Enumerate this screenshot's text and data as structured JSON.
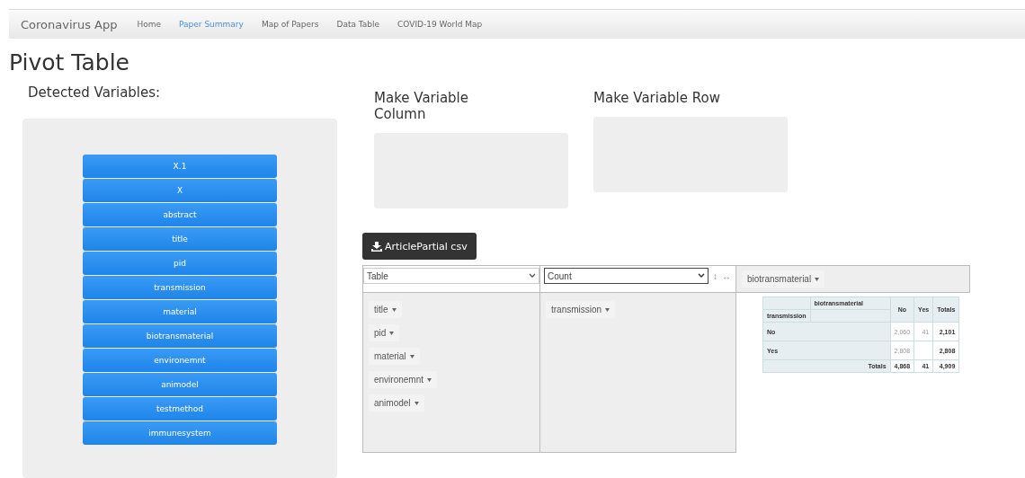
{
  "navbar": {
    "brand": "Coronavirus App",
    "items": [
      {
        "label": "Home",
        "selected": false
      },
      {
        "label": "Paper Summary",
        "selected": true
      },
      {
        "label": "Map of Papers",
        "selected": false
      },
      {
        "label": "Data Table",
        "selected": false
      },
      {
        "label": "COVID-19 World Map",
        "selected": false
      }
    ]
  },
  "title": "Pivot Table",
  "detected": {
    "heading": "Detected Variables:",
    "variables": [
      "X.1",
      "X",
      "abstract",
      "title",
      "pid",
      "transmission",
      "material",
      "biotransmaterial",
      "environemnt",
      "animodel",
      "testmethod",
      "immunesystem"
    ]
  },
  "dropzones": [
    {
      "heading": "Make Variable Column"
    },
    {
      "heading": "Make Variable Row"
    }
  ],
  "download": {
    "label": "ArticlePartial csv"
  },
  "pivot": {
    "renderer": "Table",
    "aggregator": "Count",
    "row_order": "↕",
    "col_order": "↔",
    "col_attrs": [
      "biotransmaterial"
    ],
    "unused_attrs": [
      "title",
      "pid",
      "material",
      "environemnt",
      "animodel"
    ],
    "row_attrs": [
      "transmission"
    ],
    "table": {
      "col_attr": "biotransmaterial",
      "row_attr": "transmission",
      "columns": [
        "No",
        "Yes",
        "Totals"
      ],
      "rows": [
        {
          "label": "No",
          "cells": [
            {
              "value": "2,060"
            },
            {
              "value": "41"
            },
            {
              "value": "2,101"
            }
          ]
        },
        {
          "label": "Yes",
          "cells": [
            {
              "value": "2,808"
            },
            {},
            {
              "value": "2,808"
            }
          ]
        }
      ],
      "totals": {
        "label": "Totals",
        "values": [
          "4,868",
          "41",
          "4,909"
        ]
      }
    }
  }
}
